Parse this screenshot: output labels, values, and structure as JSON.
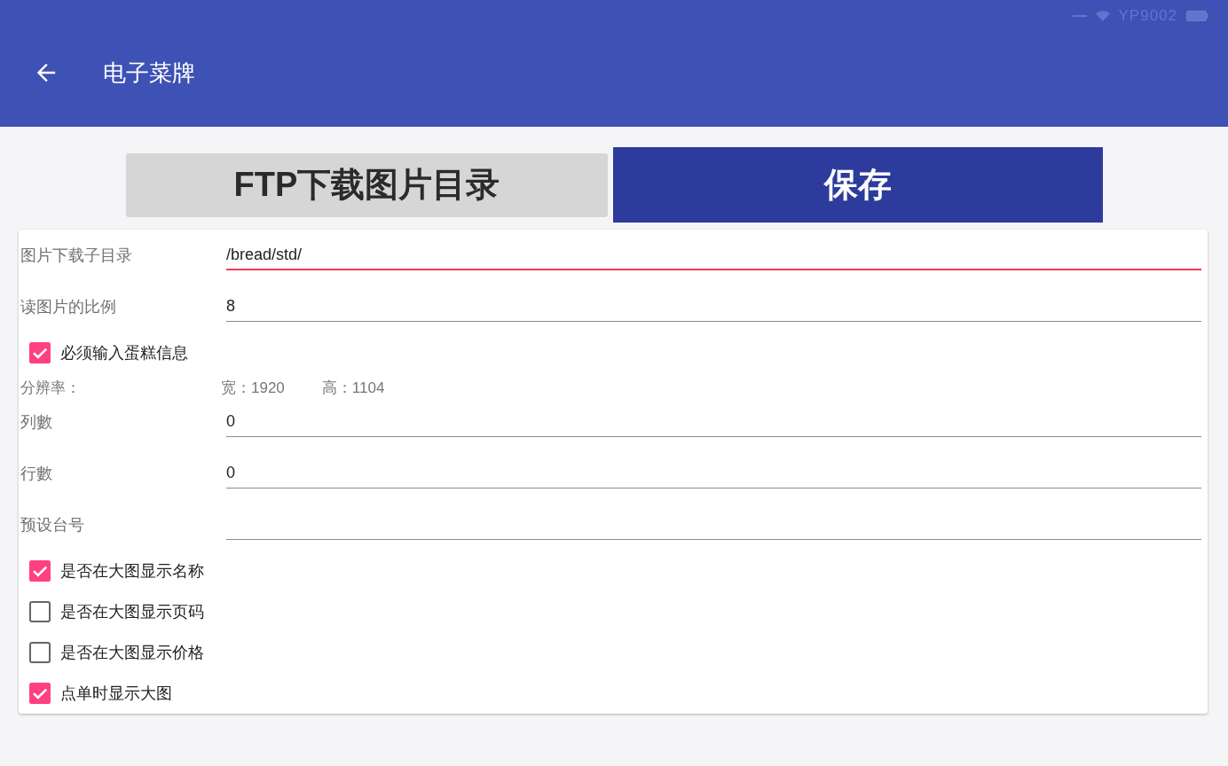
{
  "status_bar": {
    "network_name": "YP9002"
  },
  "app_bar": {
    "title": "电子菜牌"
  },
  "actions": [
    {
      "label": "FTP下载图片目录",
      "kind": "secondary"
    },
    {
      "label": "保存",
      "kind": "primary"
    }
  ],
  "form": {
    "items": [
      {
        "kind": "field",
        "label": "图片下载子目录",
        "value": "/bread/std/",
        "focused": true
      },
      {
        "kind": "field",
        "label": "读图片的比例",
        "value": "8",
        "focused": false
      },
      {
        "kind": "checkbox",
        "label": "必须输入蛋糕信息",
        "checked": true
      },
      {
        "kind": "info",
        "label": "分辨率：",
        "values": [
          "宽：1920",
          "高：1104"
        ]
      },
      {
        "kind": "field",
        "label": "列數",
        "value": "0",
        "focused": false
      },
      {
        "kind": "field",
        "label": "行數",
        "value": "0",
        "focused": false
      },
      {
        "kind": "field",
        "label": "预设台号",
        "focused": false
      },
      {
        "kind": "checkbox",
        "label": "是否在大图显示名称",
        "checked": true
      },
      {
        "kind": "checkbox",
        "label": "是否在大图显示页码",
        "checked": false
      },
      {
        "kind": "checkbox",
        "label": "是否在大图显示价格",
        "checked": false
      },
      {
        "kind": "checkbox",
        "label": "点单时显示大图",
        "checked": true
      }
    ]
  }
}
